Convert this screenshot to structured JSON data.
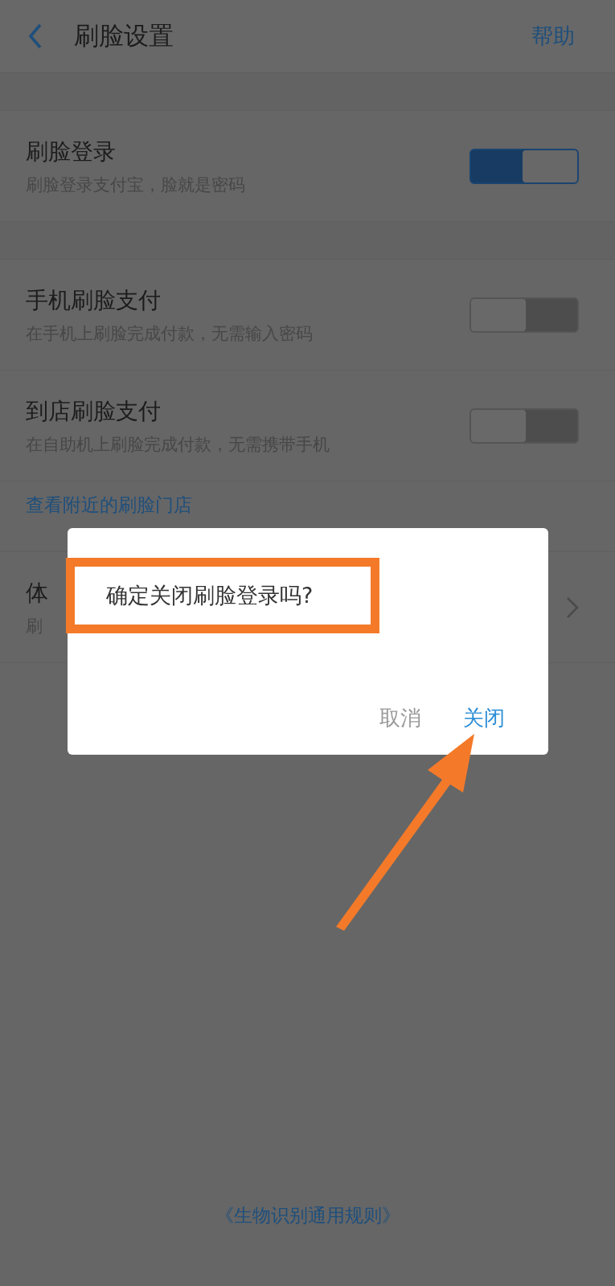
{
  "header": {
    "title": "刷脸设置",
    "action": "帮助"
  },
  "groups": [
    [
      {
        "title": "刷脸登录",
        "subtitle": "刷脸登录支付宝，脸就是密码",
        "on": true
      }
    ],
    [
      {
        "title": "手机刷脸支付",
        "subtitle": "在手机上刷脸完成付款，无需输入密码",
        "on": false
      },
      {
        "title": "到店刷脸支付",
        "subtitle": "在自助机上刷脸完成付款，无需携带手机",
        "on": false
      }
    ]
  ],
  "store_link": "查看附近的刷脸门店",
  "partial_row": {
    "title": "体",
    "subtitle": "刷"
  },
  "footer_link": "《生物识别通用规则》",
  "dialog": {
    "message": "确定关闭刷脸登录吗?",
    "buttons": [
      {
        "label": "取消",
        "kind": "cancel"
      },
      {
        "label": "关闭",
        "kind": "confirm"
      }
    ]
  }
}
